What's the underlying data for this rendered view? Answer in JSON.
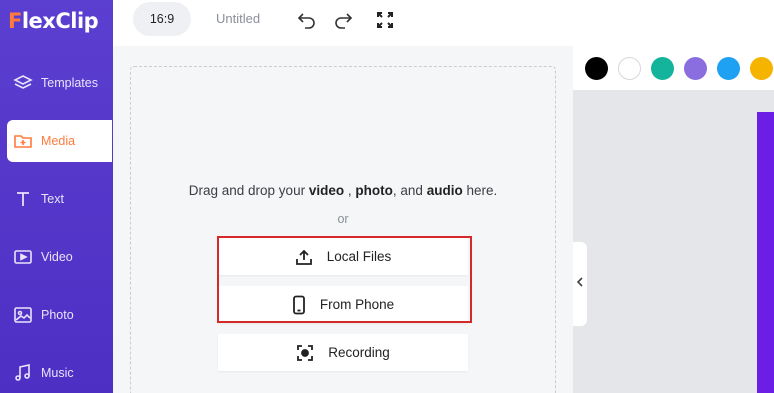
{
  "app": {
    "logo": "FlexClip"
  },
  "sidebar": {
    "items": [
      {
        "label": "Templates",
        "icon": "layers-icon"
      },
      {
        "label": "Media",
        "icon": "folder-plus-icon",
        "active": true
      },
      {
        "label": "Text",
        "icon": "text-t-icon"
      },
      {
        "label": "Video",
        "icon": "video-play-icon"
      },
      {
        "label": "Photo",
        "icon": "image-icon"
      },
      {
        "label": "Music",
        "icon": "music-note-icon"
      }
    ]
  },
  "topbar": {
    "ratio": "16:9",
    "project_title": "Untitled",
    "icons": [
      "undo-icon",
      "redo-icon",
      "fullscreen-icon"
    ]
  },
  "media": {
    "drag_prefix": "Drag and drop your",
    "drag_video": "video",
    "drag_sep1": ",",
    "drag_photo": "photo",
    "drag_sep2": ", and",
    "drag_audio": "audio",
    "drag_suffix": "here.",
    "or": "or",
    "buttons": [
      {
        "label": "Local Files",
        "icon": "upload-icon"
      },
      {
        "label": "From Phone",
        "icon": "phone-icon"
      },
      {
        "label": "Recording",
        "icon": "record-icon"
      }
    ]
  },
  "colors": {
    "accent": "#ff7a3c",
    "sidebar": "#5b3fd0",
    "highlight": "#d42a2a",
    "palette": [
      "#000000",
      "#ffffff",
      "#14b39b",
      "#8a6ee0",
      "#1ea1f2",
      "#f5b400"
    ]
  }
}
